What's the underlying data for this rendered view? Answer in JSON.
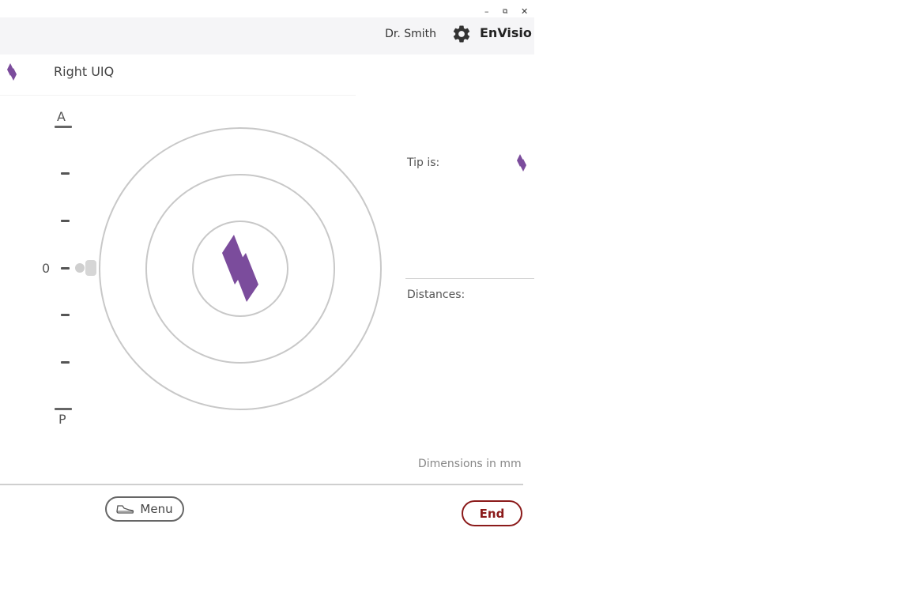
{
  "window": {
    "controls": {
      "minimize": "–",
      "restore": "⧉",
      "close": "✕"
    }
  },
  "appbar": {
    "user_name": "Dr. Smith",
    "brand": "EnVisio",
    "settings_icon": "gear-icon"
  },
  "header": {
    "title": "Right UIQ",
    "logo_icon": "envisio-logo-icon"
  },
  "scale": {
    "top_label": "A",
    "zero_label": "0",
    "bottom_label": "P"
  },
  "right_panel": {
    "tip_label": "Tip is:",
    "distances_label": "Distances:",
    "dimensions_note": "Dimensions in mm"
  },
  "footer": {
    "menu_label": "Menu",
    "end_label": "End"
  },
  "colors": {
    "accent_purple": "#7b4c9c",
    "end_red": "#8b1a1a",
    "ring_gray": "#c8c8c8"
  }
}
